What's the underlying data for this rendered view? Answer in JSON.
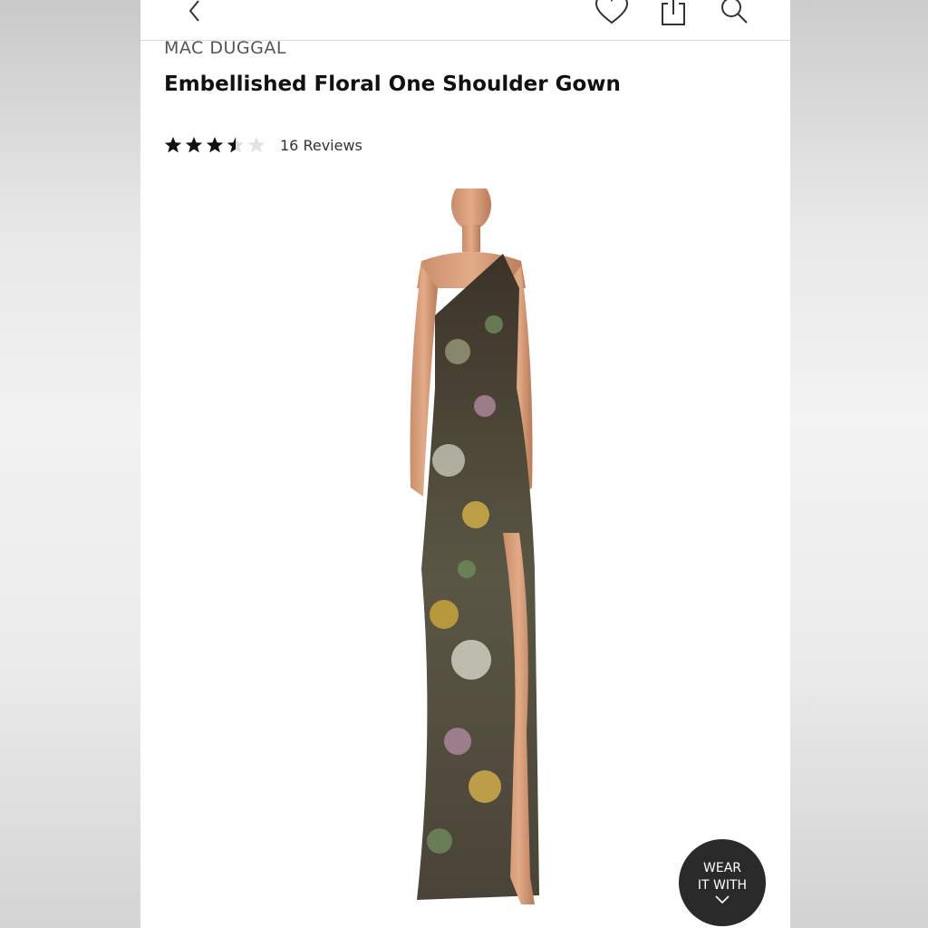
{
  "header": {
    "back_icon": "chevron-left-icon",
    "wishlist_icon": "heart-icon",
    "share_icon": "share-icon",
    "search_icon": "search-icon"
  },
  "product": {
    "brand": "MAC DUGGAL",
    "name": "Embellished Floral One Shoulder Gown",
    "rating": 3.5,
    "rating_max": 5,
    "reviews_label": "16 Reviews"
  },
  "wear_with": {
    "line1": "WEAR",
    "line2": "IT WITH",
    "icon": "chevron-down-icon"
  },
  "colors": {
    "star_filled": "#111111",
    "star_empty": "#dddddd",
    "button_bg": "#2a2a2a"
  }
}
